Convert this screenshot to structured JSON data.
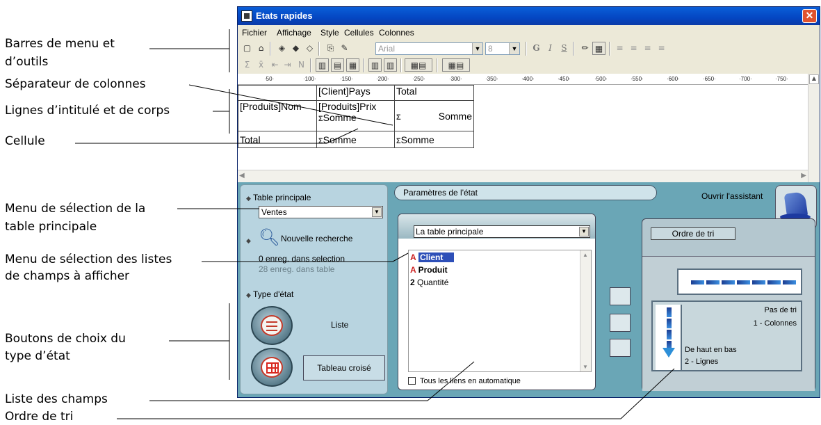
{
  "callouts": {
    "menus_toolbars_1": "Barres de menu et",
    "menus_toolbars_2": "d’outils",
    "column_separator": "Séparateur de colonnes",
    "header_body_lines": "Lignes d’intitulé et de corps",
    "cell": "Cellule",
    "main_table_menu_1": "Menu de sélection de la",
    "main_table_menu_2": "table principale",
    "field_lists_menu_1": "Menu de sélection des listes",
    "field_lists_menu_2": "de champs à afficher",
    "report_type_buttons_1": "Boutons de choix du",
    "report_type_buttons_2": "type d’état",
    "field_list": "Liste des champs",
    "sort_order": "Ordre de tri"
  },
  "window": {
    "title": "Etats rapides",
    "close_label": "✕"
  },
  "menubar": [
    "Fichier",
    "Affichage",
    "Style",
    "Cellules",
    "Colonnes"
  ],
  "toolbar": {
    "font_name": "Arial",
    "font_size": "8",
    "bold_label": "G",
    "italic_label": "I",
    "underline_label": "S"
  },
  "ruler": {
    "ticks": [
      "·50·",
      "·100·",
      "·150·",
      "·200·",
      "·250·",
      "·300·",
      "·350·",
      "·400·",
      "·450·",
      "·500·",
      "·550·",
      "·600·",
      "·650·",
      "·700·",
      "·750·"
    ]
  },
  "grid": {
    "header": [
      "",
      "[Client]Pays",
      "Total"
    ],
    "body_col1": "[Produits]Nom",
    "body_col2_line1": "[Produits]Prix",
    "body_col2_line2": "Somme",
    "body_col3": "Somme",
    "total_col1": "Total",
    "total_col2": "Somme",
    "total_col3": "Somme",
    "sigma_symbol": "Σ"
  },
  "left_panel": {
    "main_table_label": "Table principale",
    "main_table_value": "Ventes",
    "new_search_label": "Nouvelle recherche",
    "records_selected": "0 enreg. dans selection",
    "records_in_table": "28 enreg. dans table",
    "report_type_label": "Type d'état",
    "list_label": "Liste",
    "cross_table_label": "Tableau croisé"
  },
  "right_area": {
    "params_label": "Paramètres de l'état",
    "wizard_label": "Ouvrir l'assistant",
    "table_select_value": "La table principale",
    "fields": [
      {
        "name": "Client",
        "icon": "A",
        "selected": true
      },
      {
        "name": "Produit",
        "icon": "A",
        "selected": false
      },
      {
        "name": "Quantité",
        "icon": "2",
        "selected": false
      }
    ],
    "auto_links_label": "Tous les liens en automatique",
    "sort_tab_label": "Ordre de tri",
    "no_sort_label": "Pas de tri",
    "columns_label": "1 - Colonnes",
    "top_bottom_label": "De haut en bas",
    "rows_label": "2 - Lignes"
  },
  "colors": {
    "title_bar": "#0446c2",
    "lower_background": "#6aa6b6",
    "selection": "#2d4fb8"
  }
}
